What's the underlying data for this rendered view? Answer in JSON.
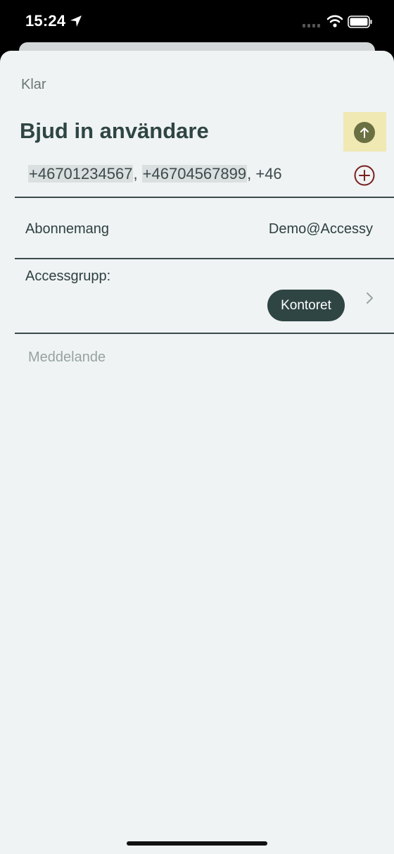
{
  "status_bar": {
    "time": "15:24"
  },
  "sheet": {
    "done_label": "Klar",
    "title": "Bjud in användare",
    "recipients": {
      "numbers": [
        "+46701234567",
        "+46704567899"
      ],
      "separator": ", ",
      "pending": "+46"
    },
    "subscription": {
      "label": "Abonnemang",
      "value": "Demo@Accessy"
    },
    "access_group": {
      "label": "Accessgrupp:",
      "selected": "Kontoret"
    },
    "message": {
      "placeholder": "Meddelande",
      "value": ""
    }
  },
  "icons": {
    "send": "arrow-up-icon",
    "add": "plus-circle-icon",
    "chevron": "chevron-right-icon",
    "location": "location-arrow-icon",
    "wifi": "wifi-icon",
    "battery": "battery-icon",
    "signal": "cellular-signal-icon"
  },
  "colors": {
    "background": "#eff3f3",
    "primary_dark": "#2f4544",
    "send_highlight": "#f0e9b4",
    "send_button": "#6b7042",
    "add_accent": "#7a1f1f",
    "chip_bg": "#dadfdf"
  }
}
